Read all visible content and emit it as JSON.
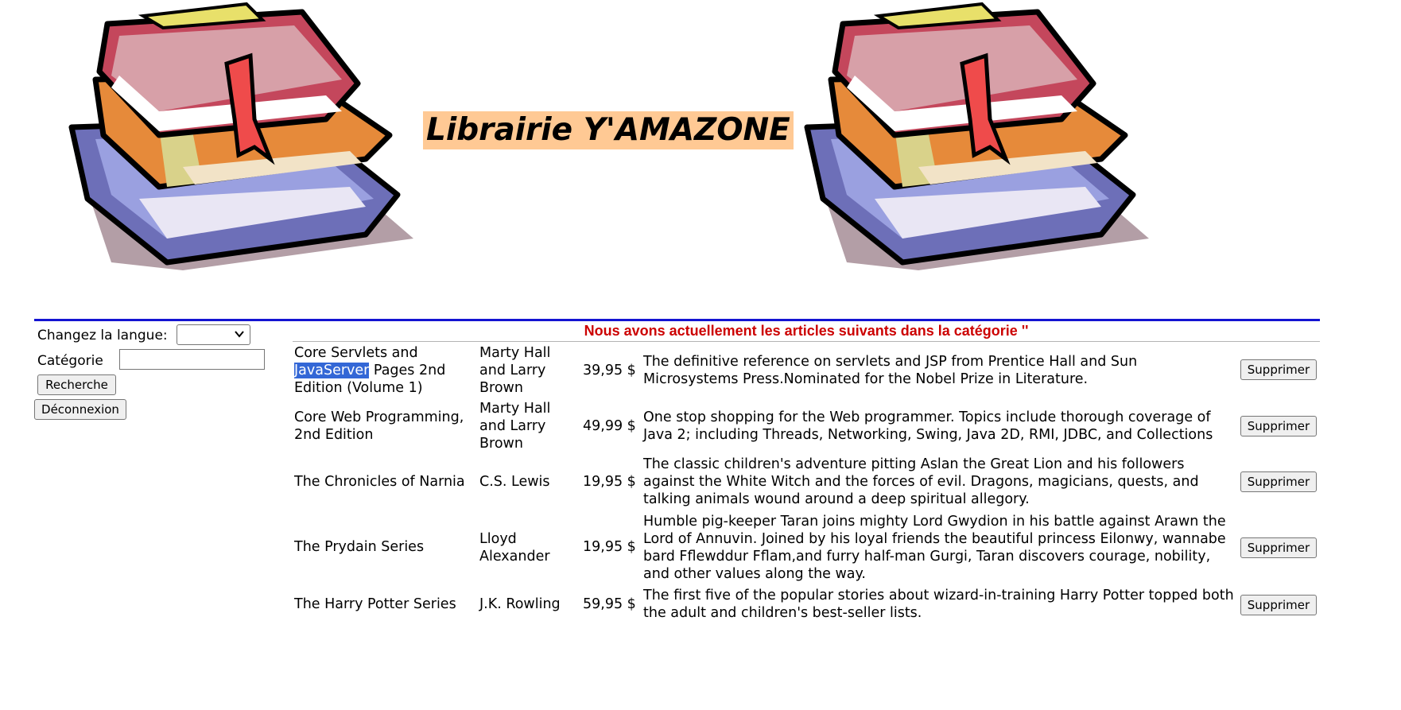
{
  "header": {
    "title": "Librairie Y'AMAZONE"
  },
  "sidebar": {
    "language_label": "Changez la langue:",
    "language_value": "",
    "category_label": "Catégorie",
    "category_value": "",
    "search_button": "Recherche",
    "logout_button": "Déconnexion"
  },
  "main": {
    "banner": "Nous avons actuellement les articles suivants dans la catégorie ''",
    "delete_label": "Supprimer",
    "selected_text": "JavaServer",
    "items": [
      {
        "title_before": "Core Servlets and ",
        "title_selected": "JavaServer",
        "title_after": " Pages 2nd Edition (Volume 1)",
        "author": "Marty Hall and Larry Brown",
        "price": "39,95 $",
        "description": "The definitive reference on servlets and JSP from Prentice Hall and Sun Microsystems Press.Nominated for the Nobel Prize in Literature."
      },
      {
        "title": "Core Web Programming, 2nd Edition",
        "author": "Marty Hall and Larry Brown",
        "price": "49,99 $",
        "description": "One stop shopping for the Web programmer. Topics include thorough coverage of Java 2; including Threads, Networking, Swing, Java 2D, RMI, JDBC, and Collections"
      },
      {
        "title": "The Chronicles of Narnia",
        "author": "C.S. Lewis",
        "price": "19,95 $",
        "description": "The classic children's adventure pitting Aslan the Great Lion and his followers against the White Witch and the forces of evil. Dragons, magicians, quests, and talking animals wound around a deep spiritual allegory."
      },
      {
        "title": "The Prydain Series",
        "author": "Lloyd Alexander",
        "price": "19,95 $",
        "description": "Humble pig-keeper Taran joins mighty Lord Gwydion in his battle against Arawn the Lord of Annuvin. Joined by his loyal friends the beautiful princess Eilonwy, wannabe bard Fflewddur Fflam,and furry half-man Gurgi, Taran discovers courage, nobility, and other values along the way."
      },
      {
        "title": "The Harry Potter Series",
        "author": "J.K. Rowling",
        "price": "59,95 $",
        "description": "The first five of the popular stories about wizard-in-training Harry Potter topped both the adult and children's best-seller lists."
      }
    ]
  },
  "colors": {
    "title_bg": "#ffc994",
    "rule_blue": "#1414d2",
    "banner_red": "#cc0000",
    "selection": "#3367d6"
  }
}
